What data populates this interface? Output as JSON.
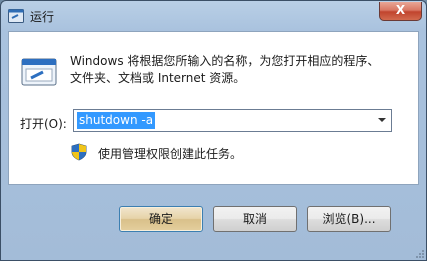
{
  "window": {
    "title": "运行",
    "close_glyph": "X"
  },
  "description": {
    "line1": "Windows 将根据您所输入的名称，为您打开相应的程序、",
    "line2": "文件夹、文档或 Internet 资源。"
  },
  "open_field": {
    "label": "打开(O):",
    "value": "shutdown -a"
  },
  "admin_note": "使用管理权限创建此任务。",
  "buttons": {
    "ok": "确定",
    "cancel": "取消",
    "browse": "浏览(B)..."
  },
  "colors": {
    "selection": "#3399ff",
    "default_button": "#e6d3a8",
    "close_button": "#c1442e"
  }
}
